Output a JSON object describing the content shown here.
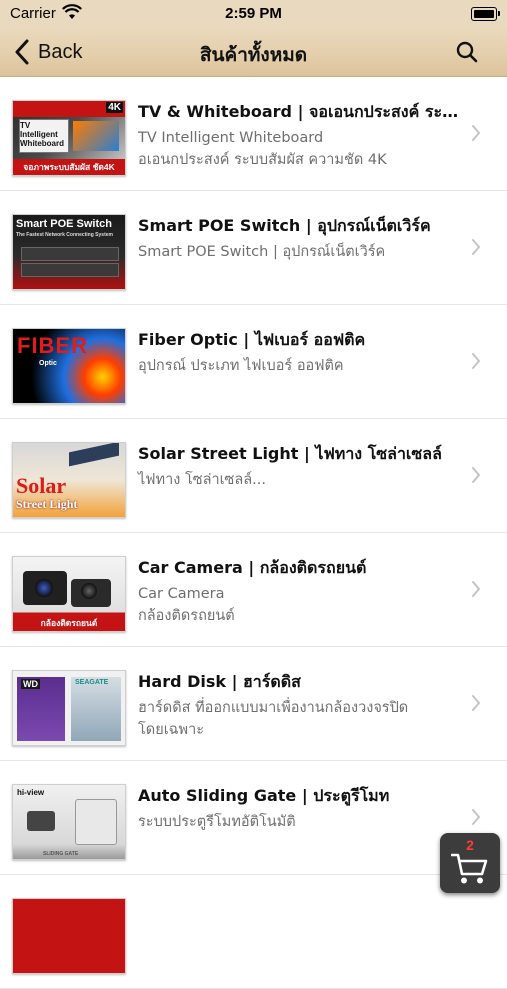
{
  "status": {
    "carrier": "Carrier",
    "time": "2:59 PM"
  },
  "nav": {
    "back_label": "Back",
    "title": "สินค้าทั้งหมด"
  },
  "products": [
    {
      "name": "TV  & Whiteboard |  จอเอนกประสงค์ ระบบสัมผัส",
      "desc": "TV Intelligent Whiteboard\nอเอนกประสงค์ ระบบสัมผัส ความชัด 4K",
      "thumb": {
        "label": "TV Intelligent Whiteboard",
        "badge": "4K",
        "caption": "จอภาพระบบสัมผัส ชัด4K"
      }
    },
    {
      "name": "Smart POE Switch | อุปกรณ์เน็ตเวิร์ค",
      "desc": "Smart POE Switch | อุปกรณ์เน็ตเวิร์ค",
      "thumb": {
        "label": "Smart POE Switch",
        "caption": "The Fastest Network Connecting System"
      }
    },
    {
      "name": "Fiber Optic | ไฟเบอร์ ออฟติค",
      "desc": "อุปกรณ์ ประเภท ไฟเบอร์ ออฟติค",
      "thumb": {
        "label": "FIBER",
        "caption": "Optic"
      }
    },
    {
      "name": "Solar Street Light  | ไฟทาง โซล่าเซลล์",
      "desc": "ไฟทาง โซล่าเซลล์...",
      "thumb": {
        "label": "Solar",
        "caption": "Street Light"
      }
    },
    {
      "name": "Car Camera | กล้องติดรถยนต์",
      "desc": "Car Camera\nกล้องติดรถยนต์",
      "thumb": {
        "caption": "กล้องติดรถยนต์"
      }
    },
    {
      "name": "Hard Disk | ฮาร์ดดิส",
      "desc": "ฮาร์ดดิส  ที่ออกแบบมาเพื่องานกล้องวงจรปิด\nโดยเฉพาะ",
      "thumb": {
        "label": "WD",
        "caption": "SEAGATE"
      }
    },
    {
      "name": "Auto Sliding Gate | ประตูรีโมท",
      "desc": "ระบบประตูรีโมทอัติโนมัติ",
      "thumb": {
        "label": "hi-view",
        "caption": "SLIDING GATE"
      }
    }
  ],
  "cart": {
    "count": "2"
  },
  "colors": {
    "nav_bg": "#e3ceaa",
    "cart_badge": "#ff3b30"
  }
}
